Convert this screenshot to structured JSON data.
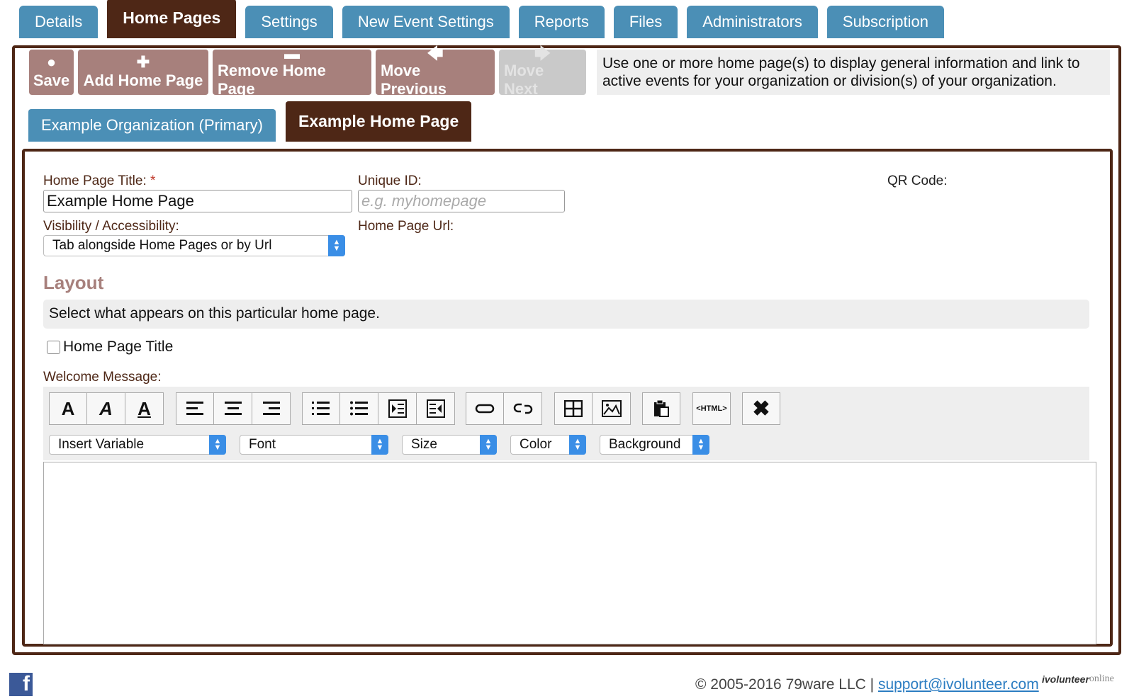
{
  "tabs": [
    "Details",
    "Home Pages",
    "Settings",
    "New Event Settings",
    "Reports",
    "Files",
    "Administrators",
    "Subscription"
  ],
  "active_tab": "Home Pages",
  "toolbar": {
    "save": "Save",
    "add": "Add Home Page",
    "remove": "Remove Home Page",
    "previous": "Move Previous",
    "next": "Move Next",
    "note": "Use one or more home page(s) to display general information and link to active events for your organization or division(s) of your organization."
  },
  "sub_tabs": [
    "Example Organization (Primary)",
    "Example Home Page"
  ],
  "form": {
    "title_label": "Home Page Title:",
    "required_mark": "*",
    "title_value": "Example Home Page",
    "unique_id_label": "Unique ID:",
    "unique_id_placeholder": "e.g. myhomepage",
    "qr_label": "QR Code:",
    "visibility_label": "Visibility / Accessibility:",
    "visibility_value": "Tab alongside Home Pages or by Url",
    "url_label": "Home Page Url:"
  },
  "layout": {
    "heading": "Layout",
    "info": "Select what appears on this particular home page.",
    "checkbox_label": "Home Page Title",
    "welcome_label": "Welcome Message:",
    "dropdowns": [
      "Insert Variable",
      "Font",
      "Size",
      "Color",
      "Background"
    ]
  },
  "footer": {
    "copyright": "© 2005-2016 79ware LLC |",
    "email": "support@ivolunteer.com",
    "logo_a": "ivolunteer",
    "logo_b": "online"
  },
  "colors": {
    "tab_blue": "#4b8fb6",
    "brand_brown": "#4e2716",
    "button_rose": "#a7807c"
  }
}
